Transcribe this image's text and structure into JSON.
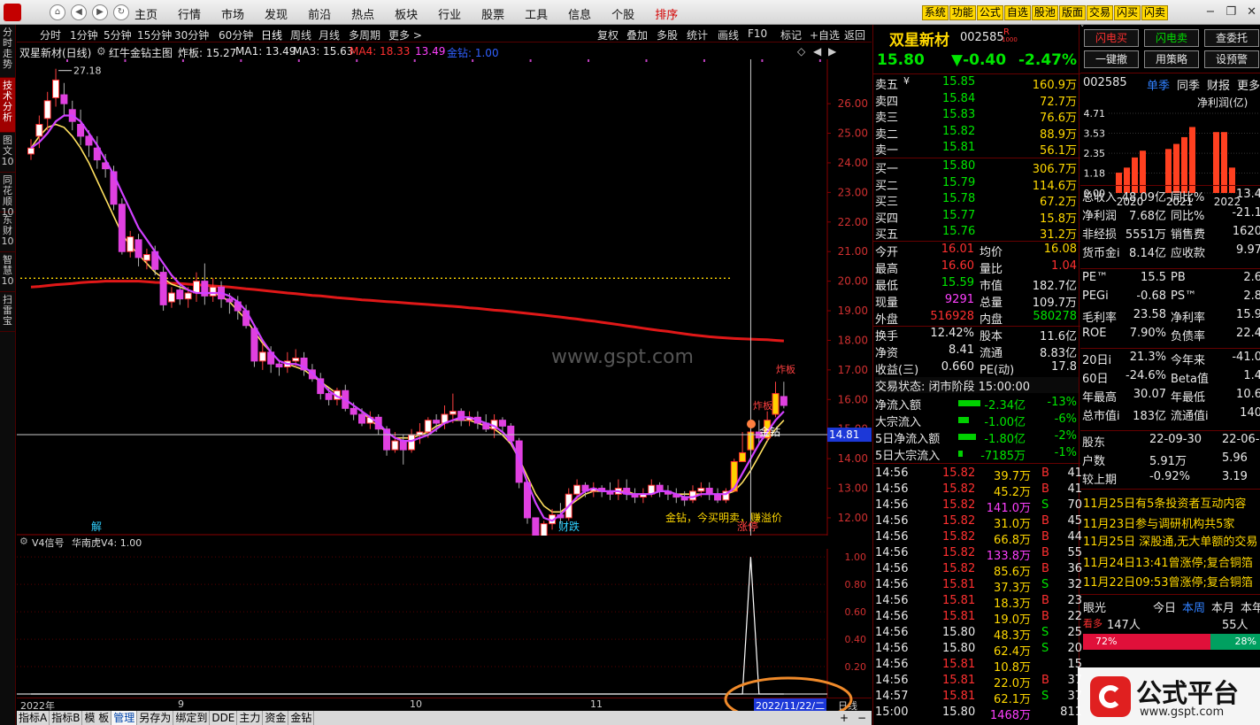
{
  "menubar": {
    "items": [
      "主页",
      "行情",
      "市场",
      "发现",
      "前沿",
      "热点",
      "板块",
      "行业",
      "股票",
      "工具",
      "信息",
      "个股",
      "排序"
    ],
    "active_index": 12,
    "tool_buttons": [
      "系统",
      "功能",
      "公式",
      "自选",
      "股池",
      "版面",
      "交易",
      "闪买",
      "闪卖"
    ],
    "window_controls": [
      "−",
      "❐",
      "✕"
    ]
  },
  "left_tabs": [
    {
      "label": "分时走势",
      "active": false
    },
    {
      "label": "技术分析",
      "active": true
    },
    {
      "label": "图文10",
      "active": false
    },
    {
      "label": "同花顺10",
      "active": false
    },
    {
      "label": "东财10",
      "active": false
    },
    {
      "label": "智慧10",
      "active": false
    },
    {
      "label": "扫雷宝",
      "active": false
    }
  ],
  "period_bar": {
    "periods": [
      "分时",
      "1分钟",
      "5分钟",
      "15分钟",
      "30分钟",
      "60分钟",
      "日线",
      "周线",
      "月线",
      "多周期",
      "更多 >"
    ],
    "active_index": 6,
    "right_buttons": [
      "复权",
      "叠加",
      "多股",
      "统计",
      "画线",
      "F10",
      "标记",
      "+自选",
      "返回"
    ]
  },
  "info_bar": {
    "stock_title": "双星新材(日线)",
    "formula": "红牛金钻主图",
    "zhaban": "炸板: 15.27",
    "ma1": "MA1: 13.49",
    "ma3": "MA3: 15.63",
    "ma4": "MA4: 18.33",
    "ma4b": "13.49",
    "jinzuan": "金钻: 1.00"
  },
  "main_chart": {
    "price_axis": [
      "26.00",
      "25.00",
      "24.00",
      "23.00",
      "22.00",
      "21.00",
      "20.00",
      "19.00",
      "18.00",
      "17.00",
      "16.00",
      "15.00",
      "14.00",
      "13.00",
      "12.00"
    ],
    "price_min": 11.4,
    "price_max": 27.5,
    "current_price_label": "14.81",
    "high_label": "27.18",
    "low_label": "10.65",
    "watermark": "www.gspt.com",
    "annotations": {
      "jinzuan": "金钻",
      "signal": "金钻，今买明卖，赚溢价",
      "zhaban": "炸板",
      "jie": "解",
      "caidie": "财跌",
      "zhangting": "涨停"
    },
    "candles": [
      [
        24.3,
        24.5,
        24.1,
        24.8
      ],
      [
        24.9,
        25.3,
        24.5,
        25.6
      ],
      [
        25.5,
        26.1,
        25.1,
        26.4
      ],
      [
        26.2,
        26.8,
        25.9,
        27.18
      ],
      [
        26.3,
        26.0,
        25.6,
        26.7
      ],
      [
        25.8,
        25.4,
        25.1,
        26.1
      ],
      [
        25.3,
        24.9,
        24.6,
        25.8
      ],
      [
        24.9,
        24.6,
        24.2,
        25.1
      ],
      [
        24.5,
        24.1,
        23.8,
        24.9
      ],
      [
        24.0,
        23.8,
        23.5,
        24.3
      ],
      [
        23.7,
        22.6,
        22.4,
        23.9
      ],
      [
        22.6,
        21.0,
        20.9,
        22.8
      ],
      [
        21.0,
        21.5,
        20.8,
        21.7
      ],
      [
        21.4,
        20.8,
        20.5,
        21.6
      ],
      [
        20.7,
        20.9,
        20.4,
        21.1
      ],
      [
        21.0,
        20.4,
        20.2,
        21.2
      ],
      [
        20.3,
        19.2,
        19.0,
        20.5
      ],
      [
        19.3,
        19.6,
        19.1,
        19.8
      ],
      [
        19.7,
        19.4,
        19.2,
        19.9
      ],
      [
        19.4,
        19.6,
        19.1,
        19.8
      ],
      [
        19.6,
        20.0,
        19.3,
        20.3
      ],
      [
        20.0,
        19.5,
        19.2,
        20.6
      ],
      [
        19.5,
        19.8,
        19.3,
        20.1
      ],
      [
        19.8,
        19.4,
        19.1,
        20.0
      ],
      [
        19.4,
        19.3,
        18.9,
        19.6
      ],
      [
        19.3,
        19.0,
        18.7,
        19.5
      ],
      [
        19.0,
        18.5,
        18.4,
        19.2
      ],
      [
        18.4,
        17.3,
        17.1,
        18.5
      ],
      [
        17.3,
        17.6,
        17.0,
        17.9
      ],
      [
        17.6,
        17.2,
        16.9,
        17.8
      ],
      [
        17.2,
        17.1,
        16.8,
        17.3
      ],
      [
        17.1,
        17.3,
        16.9,
        17.6
      ],
      [
        17.3,
        17.4,
        17.1,
        17.7
      ],
      [
        17.4,
        17.0,
        16.8,
        17.6
      ],
      [
        17.0,
        16.7,
        16.6,
        17.2
      ],
      [
        16.7,
        16.2,
        16.0,
        16.9
      ],
      [
        16.2,
        16.0,
        15.8,
        16.4
      ],
      [
        16.0,
        16.3,
        15.8,
        16.4
      ],
      [
        16.3,
        15.7,
        15.6,
        16.5
      ],
      [
        15.7,
        15.5,
        15.3,
        15.9
      ],
      [
        15.5,
        15.2,
        15.1,
        15.7
      ],
      [
        15.2,
        15.4,
        15.0,
        15.6
      ],
      [
        15.4,
        15.0,
        14.8,
        15.5
      ],
      [
        15.0,
        14.3,
        14.1,
        15.1
      ],
      [
        14.3,
        14.6,
        14.2,
        14.9
      ],
      [
        14.6,
        14.3,
        13.8,
        14.8
      ],
      [
        14.3,
        14.8,
        14.2,
        15.0
      ],
      [
        14.8,
        14.9,
        14.5,
        15.2
      ],
      [
        14.9,
        15.3,
        14.7,
        15.4
      ],
      [
        15.3,
        15.2,
        14.9,
        15.5
      ],
      [
        15.2,
        15.5,
        15.0,
        15.8
      ],
      [
        15.5,
        15.6,
        15.2,
        16.2
      ],
      [
        15.6,
        15.3,
        15.1,
        15.7
      ],
      [
        15.3,
        15.4,
        15.1,
        15.6
      ],
      [
        15.4,
        15.2,
        15.0,
        15.6
      ],
      [
        15.2,
        15.0,
        14.9,
        15.5
      ],
      [
        15.0,
        15.3,
        14.7,
        15.5
      ],
      [
        15.3,
        15.1,
        14.9,
        15.4
      ],
      [
        15.1,
        14.6,
        14.5,
        15.2
      ],
      [
        14.6,
        13.2,
        13.0,
        14.7
      ],
      [
        13.2,
        12.0,
        11.8,
        13.2
      ],
      [
        12.0,
        11.2,
        10.65,
        12.0
      ],
      [
        11.2,
        11.8,
        11.1,
        11.9
      ],
      [
        11.8,
        12.1,
        11.6,
        12.3
      ],
      [
        12.1,
        12.0,
        11.8,
        12.5
      ],
      [
        12.0,
        12.8,
        11.9,
        13.0
      ],
      [
        12.8,
        13.1,
        12.6,
        13.3
      ],
      [
        13.1,
        12.9,
        12.7,
        13.2
      ],
      [
        12.9,
        13.0,
        12.7,
        13.2
      ],
      [
        13.0,
        12.9,
        12.7,
        13.1
      ],
      [
        12.9,
        12.8,
        12.6,
        13.2
      ],
      [
        12.8,
        13.0,
        12.6,
        13.3
      ],
      [
        13.0,
        12.8,
        12.6,
        13.3
      ],
      [
        12.8,
        12.7,
        12.5,
        13.0
      ],
      [
        12.7,
        12.8,
        12.5,
        13.0
      ],
      [
        12.8,
        13.1,
        12.7,
        13.3
      ],
      [
        13.1,
        12.9,
        12.7,
        13.2
      ],
      [
        12.9,
        12.8,
        12.6,
        13.1
      ],
      [
        12.8,
        12.7,
        12.5,
        13.0
      ],
      [
        12.7,
        12.6,
        12.4,
        12.9
      ],
      [
        12.6,
        12.9,
        12.5,
        13.1
      ],
      [
        12.9,
        13.0,
        12.7,
        13.2
      ],
      [
        13.0,
        12.8,
        12.6,
        13.2
      ],
      [
        12.8,
        12.6,
        12.5,
        13.0
      ],
      [
        12.6,
        12.9,
        12.5,
        13.0
      ],
      [
        12.9,
        13.9,
        12.9,
        14.0
      ],
      [
        13.9,
        14.2,
        13.9,
        14.9
      ],
      [
        14.3,
        14.9,
        14.2,
        15.2
      ],
      [
        14.9,
        14.7,
        14.5,
        15.3
      ],
      [
        14.7,
        15.3,
        14.6,
        15.6
      ],
      [
        15.5,
        16.2,
        15.4,
        16.6
      ],
      [
        16.1,
        15.8,
        15.7,
        16.6
      ]
    ],
    "ma_yellow": [
      24.5,
      24.9,
      25.2,
      25.3,
      25.2,
      24.9,
      24.5,
      24.0,
      23.4,
      22.8,
      22.2,
      21.6,
      21.2,
      20.9,
      20.6,
      20.3,
      20.1,
      19.9,
      19.8,
      19.7,
      19.6,
      19.6,
      19.6,
      19.5,
      19.3,
      19.0,
      18.7,
      18.3,
      17.9,
      17.6,
      17.3,
      17.2,
      17.1,
      17.0,
      16.8,
      16.6,
      16.4,
      16.2,
      16.0,
      15.8,
      15.6,
      15.3,
      15.1,
      14.9,
      14.7,
      14.7,
      14.7,
      14.8,
      14.9,
      15.1,
      15.2,
      15.3,
      15.3,
      15.3,
      15.2,
      15.1,
      15.0,
      14.8,
      14.5,
      14.0,
      13.4,
      12.8,
      12.4,
      12.2,
      12.2,
      12.4,
      12.6,
      12.8,
      12.9,
      12.9,
      12.9,
      12.9,
      12.9,
      12.8,
      12.8,
      12.8,
      12.9,
      12.9,
      12.8,
      12.8,
      12.8,
      12.8,
      12.8,
      12.8,
      12.8,
      12.9,
      13.2,
      13.6,
      14.1,
      14.6,
      15.0,
      15.3
    ],
    "ma_pink": [
      24.5,
      24.7,
      25.0,
      25.4,
      25.6,
      25.6,
      25.4,
      25.0,
      24.6,
      24.1,
      23.6,
      23.0,
      22.4,
      21.8,
      21.4,
      21.0,
      20.6,
      20.2,
      19.9,
      19.7,
      19.6,
      19.6,
      19.6,
      19.6,
      19.5,
      19.3,
      19.0,
      18.5,
      18.0,
      17.6,
      17.3,
      17.2,
      17.2,
      17.1,
      16.9,
      16.6,
      16.3,
      16.1,
      16.0,
      15.8,
      15.6,
      15.4,
      15.2,
      14.9,
      14.7,
      14.6,
      14.6,
      14.7,
      14.8,
      15.0,
      15.2,
      15.3,
      15.4,
      15.4,
      15.3,
      15.2,
      15.1,
      14.9,
      14.6,
      14.0,
      13.2,
      12.5,
      12.0,
      11.9,
      12.1,
      12.4,
      12.7,
      12.9,
      13.0,
      12.9,
      12.9,
      12.9,
      12.8,
      12.8,
      12.8,
      12.8,
      12.9,
      12.9,
      12.8,
      12.7,
      12.7,
      12.8,
      12.8,
      12.8,
      12.8,
      13.0,
      13.5,
      14.0,
      14.5,
      14.9,
      15.3,
      15.6
    ],
    "ma_red": [
      19.8,
      19.82,
      19.85,
      19.88,
      19.9,
      19.92,
      19.95,
      19.97,
      19.98,
      20.0,
      20.0,
      20.0,
      20.0,
      20.0,
      19.98,
      19.96,
      19.95,
      19.93,
      19.92,
      19.9,
      19.88,
      19.86,
      19.84,
      19.82,
      19.8,
      19.77,
      19.74,
      19.72,
      19.69,
      19.66,
      19.63,
      19.6,
      19.58,
      19.55,
      19.52,
      19.5,
      19.47,
      19.44,
      19.42,
      19.4,
      19.37,
      19.35,
      19.33,
      19.31,
      19.29,
      19.27,
      19.25,
      19.23,
      19.21,
      19.19,
      19.17,
      19.15,
      19.13,
      19.1,
      19.08,
      19.05,
      19.02,
      19.0,
      18.97,
      18.94,
      18.91,
      18.88,
      18.85,
      18.82,
      18.79,
      18.75,
      18.72,
      18.68,
      18.65,
      18.61,
      18.57,
      18.53,
      18.49,
      18.45,
      18.41,
      18.37,
      18.33,
      18.3,
      18.26,
      18.22,
      18.18,
      18.15,
      18.12,
      18.1,
      18.08,
      18.06,
      18.05,
      18.04,
      18.03,
      18.02,
      18.0,
      17.98
    ],
    "dotted_level": 20.1,
    "crosshair_price": 14.81
  },
  "sub_chart": {
    "title": "V4信号",
    "formula": "华南虎V4: 1.00",
    "axis": [
      "1.00",
      "0.80",
      "0.60",
      "0.40",
      "0.20"
    ],
    "signal_values": [
      0,
      0,
      0,
      0,
      0,
      0,
      0,
      0,
      0,
      0,
      0,
      0,
      0,
      0,
      0,
      0,
      0,
      0,
      0,
      0,
      0,
      0,
      0,
      0,
      0,
      0,
      0,
      0,
      0,
      0,
      0,
      0,
      0,
      0,
      0,
      0,
      0,
      0,
      0,
      0,
      0,
      0,
      0,
      0,
      0,
      0,
      0,
      0,
      0,
      0,
      0,
      0,
      0,
      0,
      0,
      0,
      0,
      0,
      0,
      0,
      0,
      0,
      0,
      0,
      0,
      0,
      0,
      0,
      0,
      0,
      0,
      0,
      0,
      0,
      0,
      0,
      0,
      0,
      0,
      0,
      0,
      0,
      0,
      0,
      0,
      0,
      0,
      1,
      0,
      0,
      0,
      0
    ]
  },
  "date_bar": {
    "labels": [
      "2022年",
      "9",
      "10",
      "11"
    ],
    "cursor_date": "2022/11/22/二",
    "right_label": "日线"
  },
  "bottom_tabs": [
    "指标A",
    "指标B",
    "模 板",
    "管理",
    "另存为",
    "绑定到",
    "DDE",
    "主力",
    "资金",
    "金钻"
  ],
  "bottom_active": 3,
  "quote": {
    "name": "双星新材",
    "code": "002585",
    "badge": "R",
    "badge_sub": "1000",
    "price": "15.80",
    "change": "▼-0.40",
    "change_pct": "-2.47%",
    "sells": [
      [
        "卖五",
        "15.85",
        "160.9万"
      ],
      [
        "卖四",
        "15.84",
        "72.7万"
      ],
      [
        "卖三",
        "15.83",
        "76.6万"
      ],
      [
        "卖二",
        "15.82",
        "88.9万"
      ],
      [
        "卖一",
        "15.81",
        "56.1万"
      ]
    ],
    "sell_currency": "¥",
    "buys": [
      [
        "买一",
        "15.80",
        "306.7万"
      ],
      [
        "买二",
        "15.79",
        "114.6万"
      ],
      [
        "买三",
        "15.78",
        "67.2万"
      ],
      [
        "买四",
        "15.77",
        "15.8万"
      ],
      [
        "买五",
        "15.76",
        "31.2万"
      ]
    ],
    "stats": [
      [
        "今开",
        "16.01",
        "均价",
        "16.08"
      ],
      [
        "最高",
        "16.60",
        "量比",
        "1.04"
      ],
      [
        "最低",
        "15.59",
        "市值",
        "182.7亿"
      ],
      [
        "现量",
        "9291",
        "总量",
        "109.7万"
      ],
      [
        "外盘",
        "516928",
        "内盘",
        "580278"
      ],
      [
        "换手",
        "12.42%",
        "股本",
        "11.6亿"
      ],
      [
        "净资",
        "8.41",
        "流通",
        "8.83亿"
      ],
      [
        "收益(三)",
        "0.660",
        "PE(动)",
        "17.8"
      ]
    ],
    "status_label": "交易状态: 闭市阶段 15:00:00",
    "flows": [
      [
        "净流入额",
        "-2.34亿",
        "-13%"
      ],
      [
        "大宗流入",
        "-1.00亿",
        "-6%"
      ],
      [
        "5日净流入额",
        "-1.80亿",
        "-2%"
      ],
      [
        "5日大宗流入",
        "-7185万",
        "-1%"
      ]
    ],
    "flow_bars": [
      0.9,
      0.4,
      0.7,
      0.1
    ],
    "ticks": [
      [
        "14:56",
        "15.82",
        "39.7万",
        "B",
        "41"
      ],
      [
        "14:56",
        "15.82",
        "45.2万",
        "B",
        "41"
      ],
      [
        "14:56",
        "15.82",
        "141.0万",
        "S",
        "70"
      ],
      [
        "14:56",
        "15.82",
        "31.0万",
        "B",
        "45"
      ],
      [
        "14:56",
        "15.82",
        "66.8万",
        "B",
        "44"
      ],
      [
        "14:56",
        "15.82",
        "133.8万",
        "B",
        "55"
      ],
      [
        "14:56",
        "15.82",
        "85.6万",
        "B",
        "36"
      ],
      [
        "14:56",
        "15.81",
        "37.3万",
        "S",
        "32"
      ],
      [
        "14:56",
        "15.81",
        "18.3万",
        "B",
        "23"
      ],
      [
        "14:56",
        "15.81",
        "19.0万",
        "B",
        "22"
      ],
      [
        "14:56",
        "15.80",
        "48.3万",
        "S",
        "25"
      ],
      [
        "14:56",
        "15.80",
        "62.4万",
        "S",
        "20"
      ],
      [
        "14:56",
        "15.81",
        "10.8万",
        "",
        "15"
      ],
      [
        "14:56",
        "15.81",
        "22.0万",
        "B",
        "37"
      ],
      [
        "14:57",
        "15.81",
        "62.1万",
        "S",
        "37"
      ],
      [
        "15:00",
        "15.80",
        "1468万",
        "",
        "811"
      ]
    ]
  },
  "right_panel": {
    "buttons": [
      "闪电买",
      "闪电卖",
      "查委托",
      "一键撤",
      "用策略",
      "设预警"
    ],
    "code": "002585",
    "tabs": [
      "单季",
      "同季",
      "财报",
      "更多"
    ],
    "chart_title": "净利润(亿)",
    "y_ticks": [
      "4.71",
      "3.53",
      "2.35",
      "1.18",
      "0.00"
    ],
    "year_labels": [
      "2020",
      "2021",
      "2022"
    ],
    "profit_bars": [
      [
        1.2,
        1.5,
        2.1,
        2.5
      ],
      [
        2.6,
        2.9,
        3.3,
        3.9
      ],
      [
        3.6,
        3.6,
        1.5
      ]
    ],
    "fund_rows": [
      [
        "总收入",
        "48.09亿",
        "同比%",
        "13.4"
      ],
      [
        "净利润",
        "7.68亿",
        "同比%",
        "-21.1"
      ],
      [
        "非经损",
        "5551万",
        "销售费",
        "1620"
      ],
      [
        "货币金i",
        "8.14亿",
        "应收款",
        "9.97"
      ]
    ],
    "val_rows": [
      [
        "PE™",
        "15.5",
        "PB",
        "2.6"
      ],
      [
        "PEGi",
        "-0.68",
        "PS™",
        "2.8"
      ],
      [
        "毛利率",
        "23.58",
        "净利率",
        "15.9"
      ],
      [
        "ROE",
        "7.90%",
        "负债率",
        "22.4"
      ]
    ],
    "perf_rows": [
      [
        "20日i",
        "21.3%",
        "今年来",
        "-41.0"
      ],
      [
        "60日",
        "-24.6%",
        "Beta值",
        "1.4"
      ],
      [
        "年最高",
        "30.07",
        "年最低",
        "10.6"
      ],
      [
        "总市值i",
        "183亿",
        "流通值i",
        "140"
      ]
    ],
    "holder_rows": [
      [
        "股东",
        "22-09-30",
        "22-06-3"
      ],
      [
        "户数",
        "5.91万",
        "5.96"
      ],
      [
        "较上期",
        "-0.92%",
        "3.19"
      ]
    ],
    "news_header": "11月25日有5条投资者互动内容",
    "news": [
      "11月23日参与调研机构共5家",
      "11月25日 深股通,无大单额的交易",
      "11月24日13:41曾涨停;复合铜箔",
      "11月22日09:53曾涨停;复合铜箔"
    ],
    "eyes": {
      "label": "眼光",
      "tabs": [
        "今日",
        "本周",
        "本月",
        "本年"
      ],
      "bull_label": "看多",
      "bull_count": "147人",
      "bear_count": "55人",
      "bull_pct": "72%",
      "bear_pct": "28%"
    }
  },
  "brand": {
    "logo_text": "公式平台",
    "url": "www.gspt.com"
  }
}
